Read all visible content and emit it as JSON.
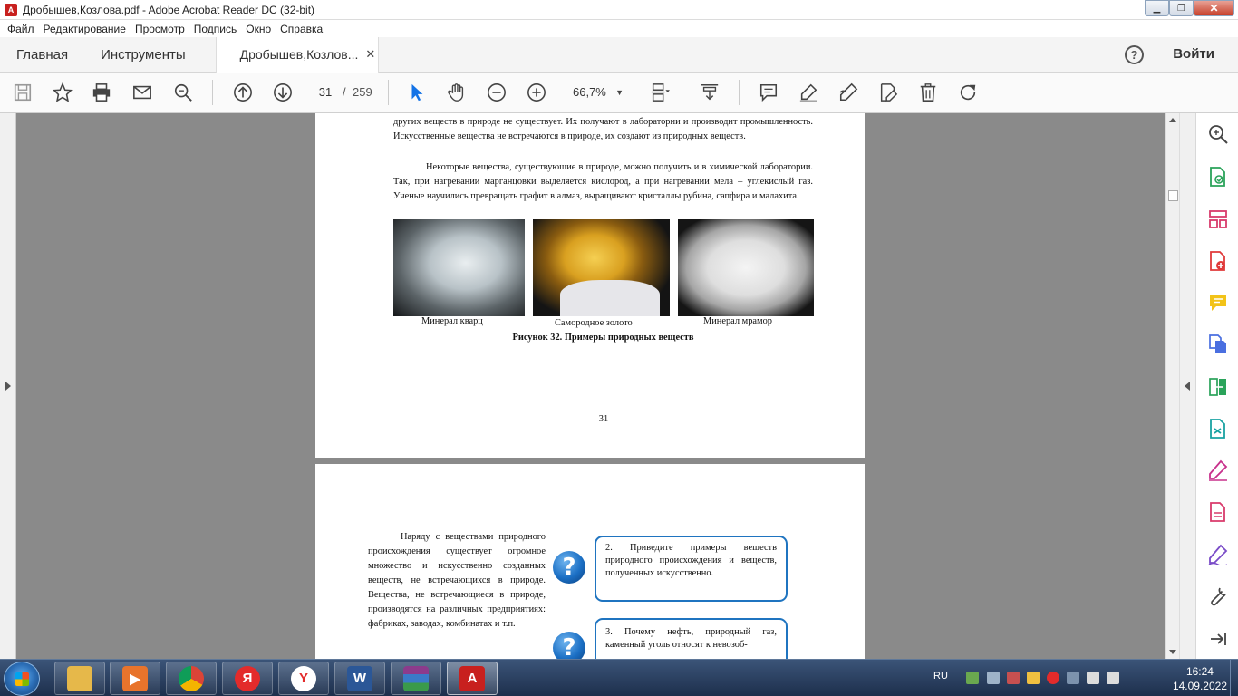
{
  "window": {
    "title": "Дробышев,Козлова.pdf - Adobe Acrobat Reader DC (32-bit)",
    "minimize_icon": "minimize-icon",
    "maximize_icon": "restore-icon",
    "close_icon": "close-icon"
  },
  "menu": [
    "Файл",
    "Редактирование",
    "Просмотр",
    "Подпись",
    "Окно",
    "Справка"
  ],
  "tabs": {
    "home": "Главная",
    "tools": "Инструменты",
    "document": "Дробышев,Козлов...",
    "close": "✕"
  },
  "header": {
    "help": "?",
    "signin": "Войти"
  },
  "toolbar": {
    "page_current": "31",
    "page_separator": "/",
    "page_total": "259",
    "zoom": "66,7%",
    "zoom_caret": "▼"
  },
  "document": {
    "page1": {
      "para1": "других веществ в природе не существует. Их получают в лаборатории и производит промышленность. Искусственные вещества не встречаются в природе, их создают из природных веществ.",
      "para2": "Некоторые вещества, существующие в природе, можно получить и в химической лаборатории. Так, при нагревании марганцовки выделяется кислород, а при нагревании мела – углекислый газ. Ученые научились превращать графит в алмаз, выращивают кристаллы рубина, сапфира и малахита.",
      "captions": [
        "Минерал кварц",
        "Самородное золото",
        "Минерал мрамор"
      ],
      "figure_title": "Рисунок 32. Примеры природных веществ",
      "page_number": "31"
    },
    "page2": {
      "para": "Наряду с веществами природного происхождения существует огромное множество и искусственно созданных веществ, не встречающихся в природе. Вещества, не встречающиеся в природе, производятся на различных предприятиях: фабриках, заводах, комбинатах и т.п.",
      "question_mark": "?",
      "q2": "2. Приведите примеры веществ природного происхождения и веществ, полученных искусственно.",
      "q3": "3. Почему нефть, природный газ, каменный уголь относят к невозоб-"
    }
  },
  "taskbar": {
    "apps": [
      {
        "name": "explorer",
        "color": "#e6b84a"
      },
      {
        "name": "media",
        "color": "#e8742c"
      },
      {
        "name": "chrome",
        "color": "#db4437"
      },
      {
        "name": "yandex",
        "color": "#e32b2b",
        "label": "Я"
      },
      {
        "name": "yandex-browser",
        "color": "#ffffff",
        "label": "Y"
      },
      {
        "name": "word",
        "color": "#2b5797",
        "label": "W"
      },
      {
        "name": "winrar",
        "color": "#8c3b8c"
      },
      {
        "name": "acrobat",
        "color": "#c8201e"
      }
    ],
    "lang": "RU",
    "time": "16:24",
    "date": "14.09.2022"
  },
  "colors": {
    "accent": "#1473e6",
    "question_border": "#1f74c0"
  }
}
